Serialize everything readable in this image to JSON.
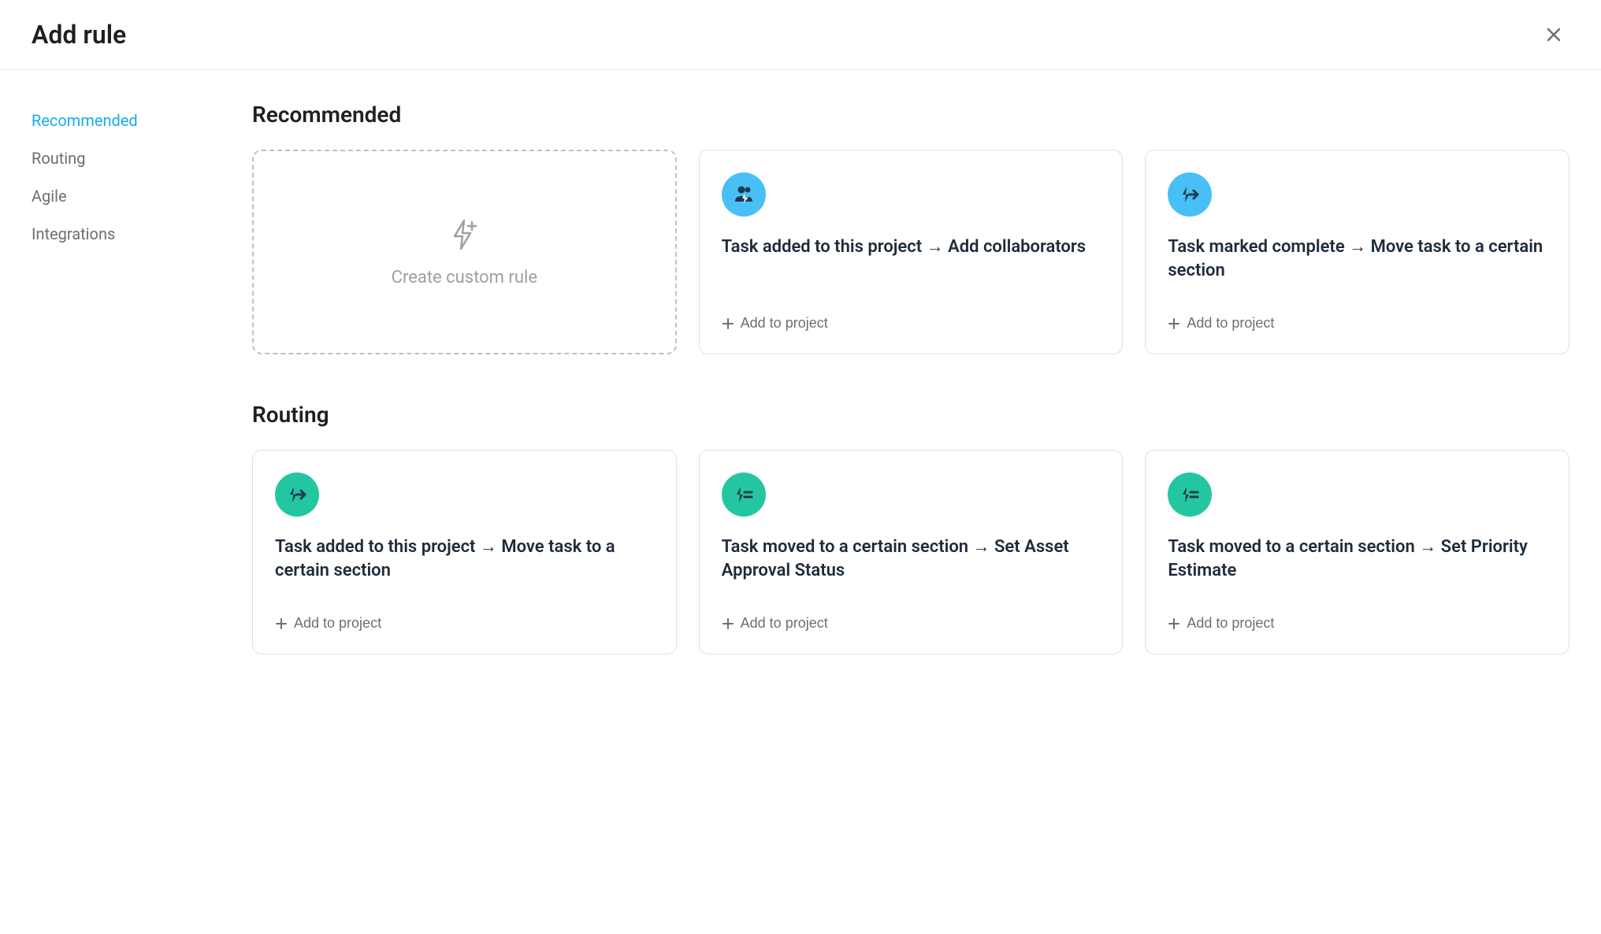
{
  "header": {
    "title": "Add rule"
  },
  "sidebar": {
    "items": [
      {
        "label": "Recommended",
        "active": true
      },
      {
        "label": "Routing",
        "active": false
      },
      {
        "label": "Agile",
        "active": false
      },
      {
        "label": "Integrations",
        "active": false
      }
    ]
  },
  "sections": {
    "recommended": {
      "title": "Recommended",
      "custom_rule_label": "Create custom rule",
      "cards": [
        {
          "title": "Task added to this project → Add collaborators",
          "action": "Add to project",
          "icon": "people-bolt",
          "color": "blue"
        },
        {
          "title": "Task marked complete → Move task to a certain section",
          "action": "Add to project",
          "icon": "bolt-arrow",
          "color": "blue"
        }
      ]
    },
    "routing": {
      "title": "Routing",
      "cards": [
        {
          "title": "Task added to this project → Move task to a certain section",
          "action": "Add to project",
          "icon": "bolt-arrow",
          "color": "teal"
        },
        {
          "title": "Task moved to a certain section → Set Asset Approval Status",
          "action": "Add to project",
          "icon": "bolt-lines",
          "color": "teal"
        },
        {
          "title": "Task moved to a certain section → Set Priority Estimate",
          "action": "Add to project",
          "icon": "bolt-lines",
          "color": "teal"
        }
      ]
    }
  }
}
